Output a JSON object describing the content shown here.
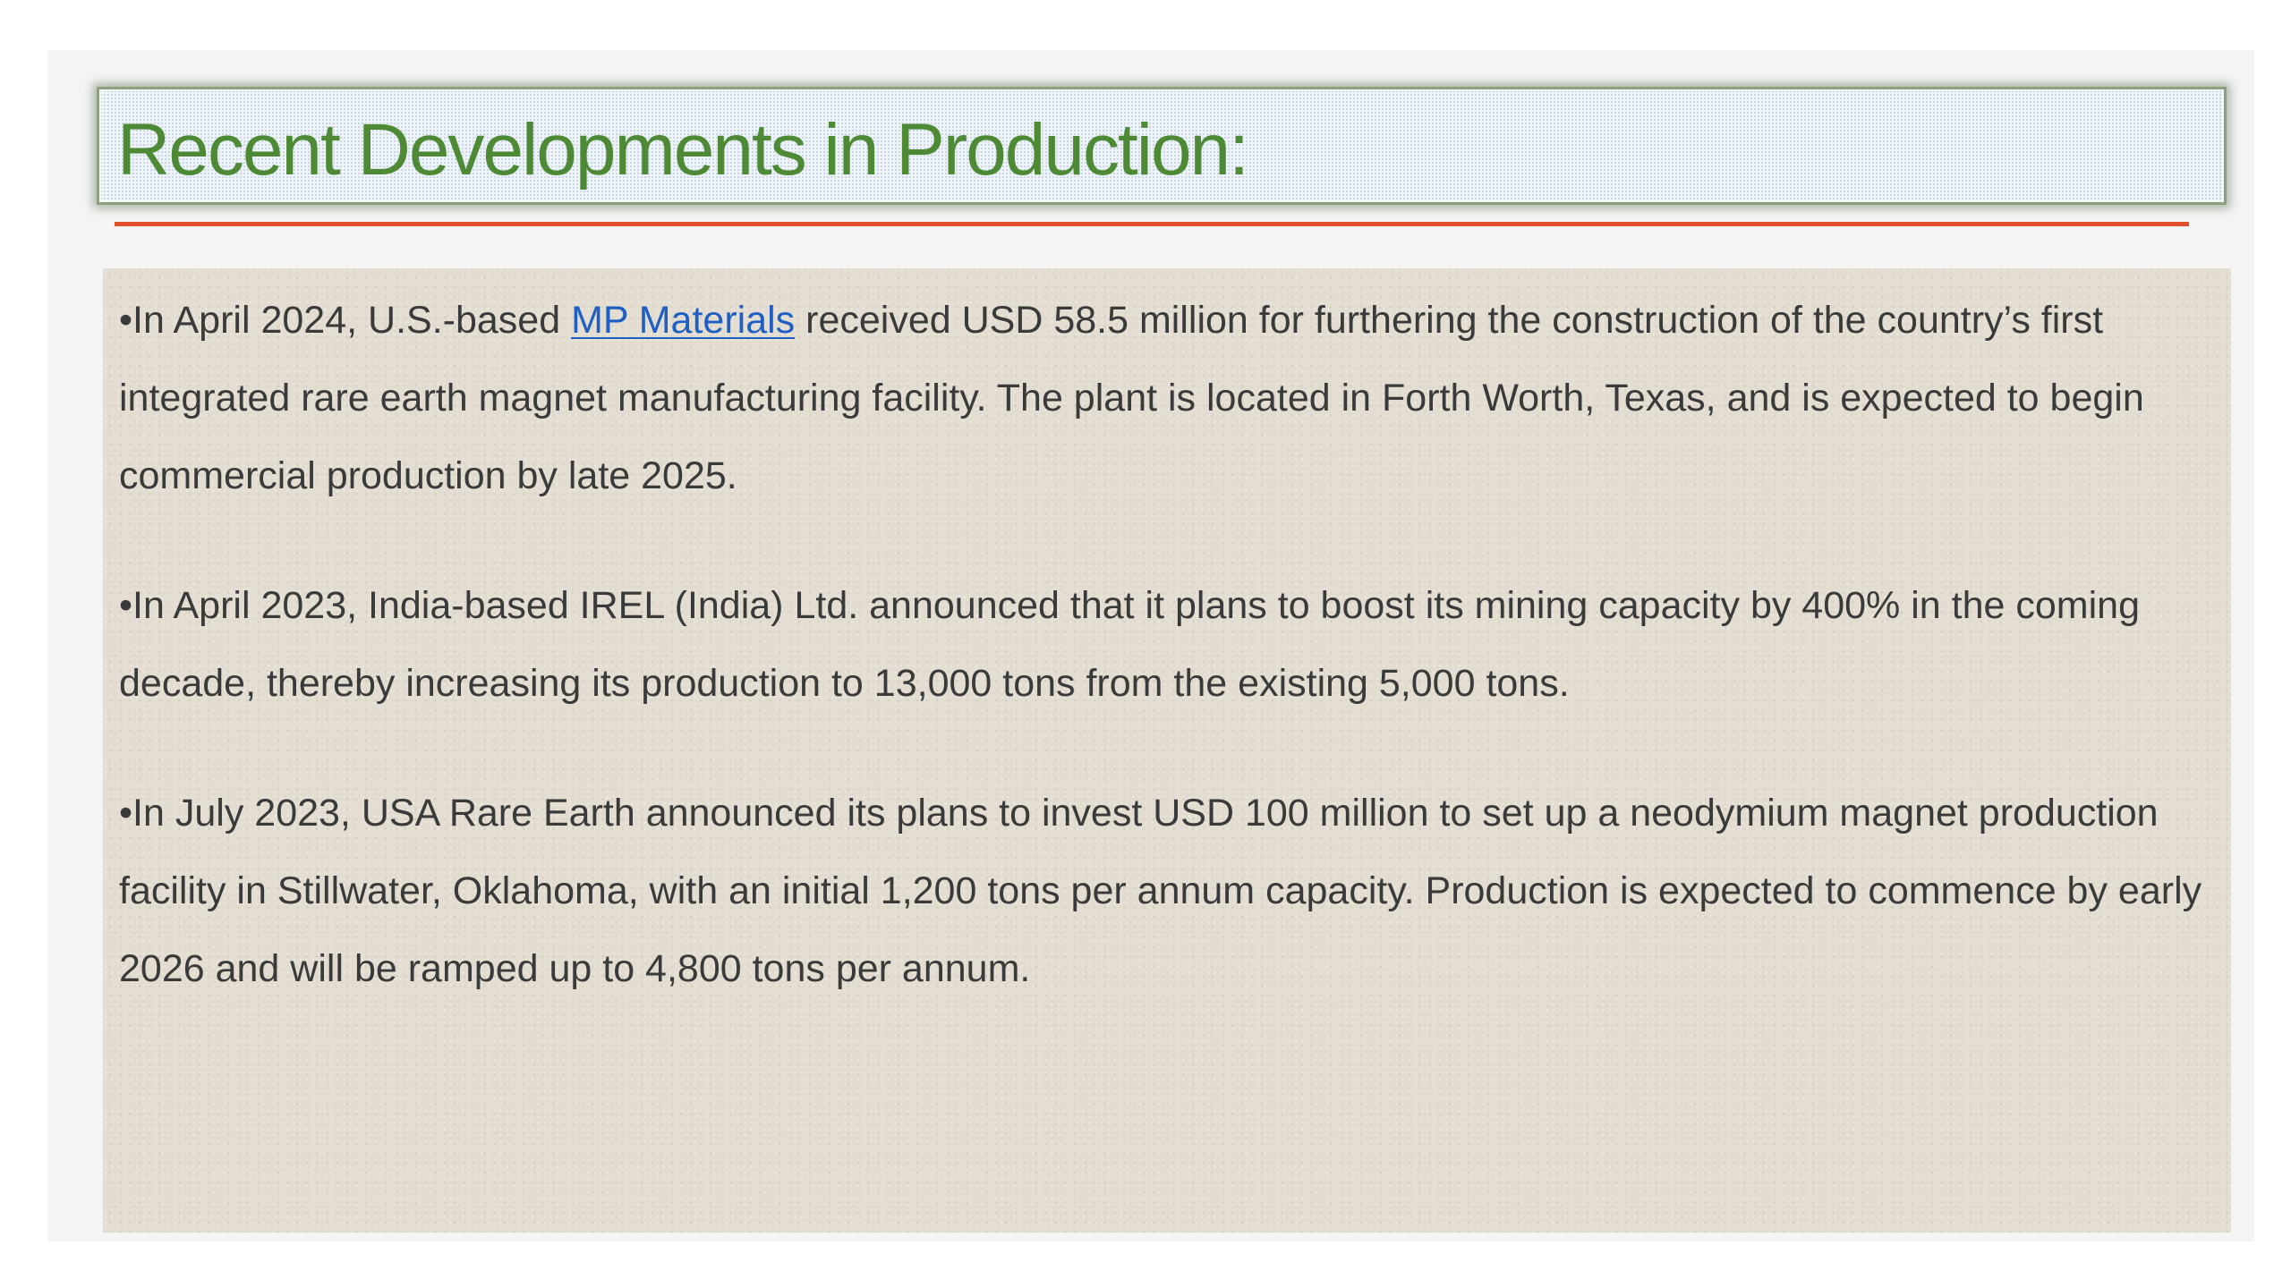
{
  "title": "Recent Developments in Production:",
  "bullets": [
    {
      "prefix": "•In April 2024, U.S.-based ",
      "link": "MP Materials",
      "suffix": " received USD 58.5 million for furthering the construction of the country’s first integrated rare earth magnet manufacturing facility. The plant is located in Forth Worth, Texas, and is expected to begin commercial production by late 2025."
    },
    {
      "text": "•In April 2023, India-based IREL (India) Ltd. announced that it plans to boost its mining capacity by 400% in the coming decade, thereby increasing its production to 13,000 tons from the existing 5,000 tons."
    },
    {
      "text": "•In July 2023, USA Rare Earth announced its plans to invest USD 100 million to set up a neodymium magnet production facility in Stillwater, Oklahoma, with an initial 1,200 tons per annum capacity. Production is expected to commence by early 2026 and will be ramped up to 4,800 tons per annum."
    }
  ],
  "colors": {
    "title": "#4e8a35",
    "rule": "#e0502c",
    "link": "#1f5fc4",
    "body_text": "#3a3a3a",
    "content_background": "#e3ddd1"
  }
}
